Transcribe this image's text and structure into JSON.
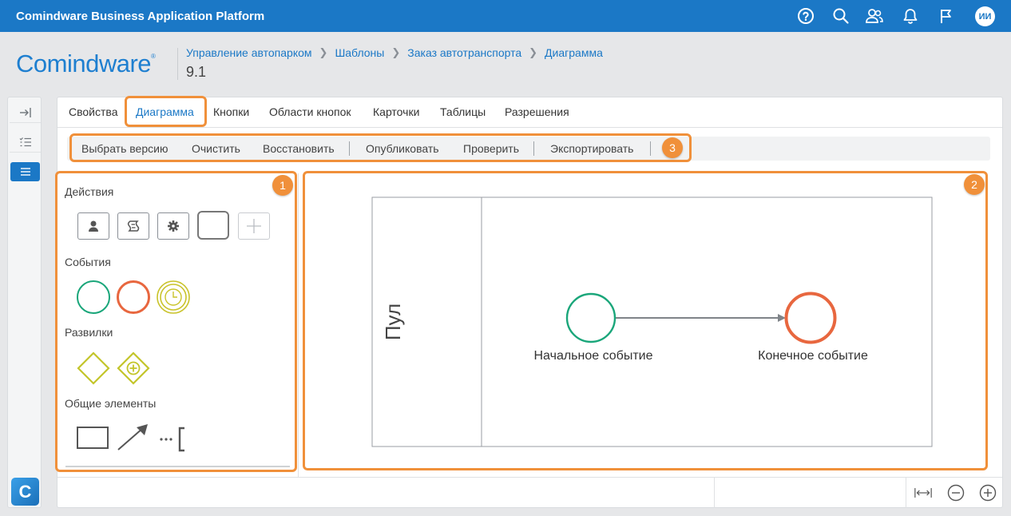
{
  "app": {
    "title": "Comindware Business Application Platform",
    "user_initials": "ИИ"
  },
  "topbar_icons": [
    "help-icon",
    "search-icon",
    "users-icon",
    "bell-icon",
    "flag-icon"
  ],
  "logo": {
    "text": "Comindware",
    "mark": "®"
  },
  "breadcrumb": [
    "Управление автопарком",
    "Шаблоны",
    "Заказ автотранспорта",
    "Диаграмма"
  ],
  "page": {
    "version": "9.1"
  },
  "tabs": [
    "Свойства",
    "Диаграмма",
    "Кнопки",
    "Области кнопок",
    "Карточки",
    "Таблицы",
    "Разрешения"
  ],
  "active_tab": "Диаграмма",
  "toolbar": [
    "Выбрать версию",
    "Очистить",
    "Восстановить",
    "Опубликовать",
    "Проверить",
    "Экспортировать"
  ],
  "palette": {
    "actions_title": "Действия",
    "events_title": "События",
    "gateways_title": "Развилки",
    "common_title": "Общие элементы"
  },
  "diagram": {
    "pool_label": "Пул",
    "start_event_label": "Начальное событие",
    "end_event_label": "Конечное событие"
  },
  "annotations": [
    "1",
    "2",
    "3"
  ],
  "colors": {
    "brand": "#1b78c6",
    "highlight": "#f0903a",
    "start_event": "#1aa67a",
    "end_event": "#e8673f",
    "timer_event": "#c9c32a",
    "gateway": "#c3c52a"
  }
}
